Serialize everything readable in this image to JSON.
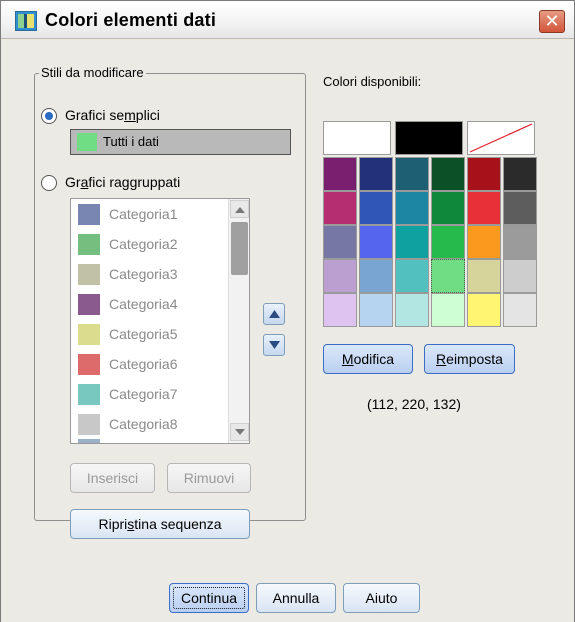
{
  "window": {
    "title": "Colori elementi dati",
    "close_glyph": "✕"
  },
  "group": {
    "legend": "Stili da modificare",
    "simple": {
      "label_before": "Grafici se",
      "label_mnemonic": "m",
      "label_after": "plici",
      "checked": true
    },
    "all_data": {
      "label": "Tutti i dati",
      "color": "#70dc84"
    },
    "grouped": {
      "label_before": "Gr",
      "label_mnemonic": "a",
      "label_after": "fici raggruppati",
      "checked": false
    },
    "list": [
      {
        "label": "Categoria1",
        "color": "#7a86b2"
      },
      {
        "label": "Categoria2",
        "color": "#74bf80"
      },
      {
        "label": "Categoria3",
        "color": "#c1c1a6"
      },
      {
        "label": "Categoria4",
        "color": "#8a5a8e"
      },
      {
        "label": "Categoria5",
        "color": "#dbdc8e"
      },
      {
        "label": "Categoria6",
        "color": "#de6b6b"
      },
      {
        "label": "Categoria7",
        "color": "#78c8c0"
      },
      {
        "label": "Categoria8",
        "color": "#c8c8c8"
      }
    ],
    "insert_label": "Inserisci",
    "remove_label": "Rimuovi",
    "reset_order": {
      "before": "Ripri",
      "mnemonic": "s",
      "after": "tina sequenza"
    }
  },
  "palette": {
    "label": "Colori disponibili:",
    "top_row": [
      "#ffffff",
      "#000000",
      "none"
    ],
    "rows": [
      [
        "#7a1f6f",
        "#23307a",
        "#1f5f73",
        "#0a5127",
        "#a7111a",
        "#2b2b2b"
      ],
      [
        "#b52e72",
        "#3057b8",
        "#1d87a3",
        "#10883c",
        "#e73038",
        "#5d5d5d"
      ],
      [
        "#7777a5",
        "#5565ee",
        "#0ea19f",
        "#25ba4b",
        "#f99a1e",
        "#9b9b9b"
      ],
      [
        "#ba9fd0",
        "#78a5d2",
        "#53c0c0",
        "#70dc84",
        "#d6d49a",
        "#cdcdcd"
      ],
      [
        "#dec3f0",
        "#b6d4ef",
        "#b1e6e2",
        "#ceffd2",
        "#fff573",
        "#e4e4e4"
      ]
    ],
    "selected_rgb": "(112, 220, 132)",
    "modify": {
      "mnemonic": "M",
      "after": "odifica"
    },
    "reset": {
      "mnemonic": "R",
      "after": "eimposta"
    }
  },
  "buttons": {
    "continue": "Continua",
    "cancel": "Annulla",
    "help": "Aiuto"
  }
}
